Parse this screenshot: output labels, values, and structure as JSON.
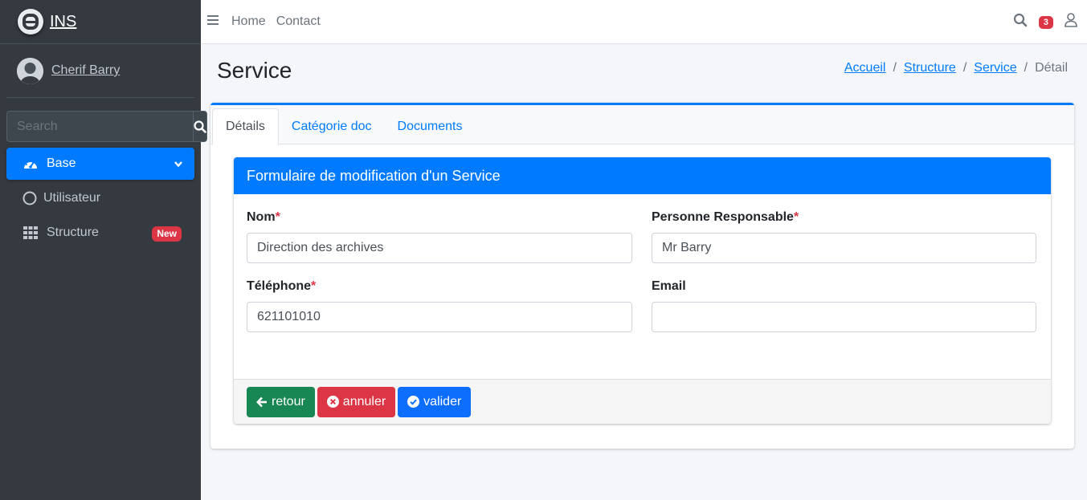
{
  "brand": {
    "name": "INS"
  },
  "user": {
    "name": "Cherif Barry"
  },
  "sidebar": {
    "search_placeholder": "Search",
    "items": [
      {
        "label": "Base",
        "icon": "dashboard-icon",
        "active": true
      },
      {
        "label": "Utilisateur",
        "icon": "circle-icon"
      },
      {
        "label": "Structure",
        "icon": "grid-icon",
        "badge": "New"
      }
    ]
  },
  "topnav": {
    "links": [
      "Home",
      "Contact"
    ],
    "notification_count": "3"
  },
  "page": {
    "title": "Service",
    "breadcrumb": [
      "Accueil",
      "Structure",
      "Service",
      "Détail"
    ]
  },
  "tabs": [
    "Détails",
    "Catégorie doc",
    "Documents"
  ],
  "form": {
    "title": "Formulaire de modification d'un Service",
    "fields": {
      "nom": {
        "label": "Nom",
        "required": "*",
        "value": "Direction des archives"
      },
      "responsable": {
        "label": "Personne Responsable",
        "required": "*",
        "value": "Mr Barry"
      },
      "telephone": {
        "label": "Téléphone",
        "required": "*",
        "value": "621101010"
      },
      "email": {
        "label": "Email",
        "value": ""
      }
    },
    "buttons": {
      "back": "retour",
      "cancel": "annuler",
      "submit": "valider"
    }
  },
  "colors": {
    "primary": "#007bff",
    "success": "#198754",
    "danger": "#dc3545",
    "sidebar": "#343a40"
  }
}
